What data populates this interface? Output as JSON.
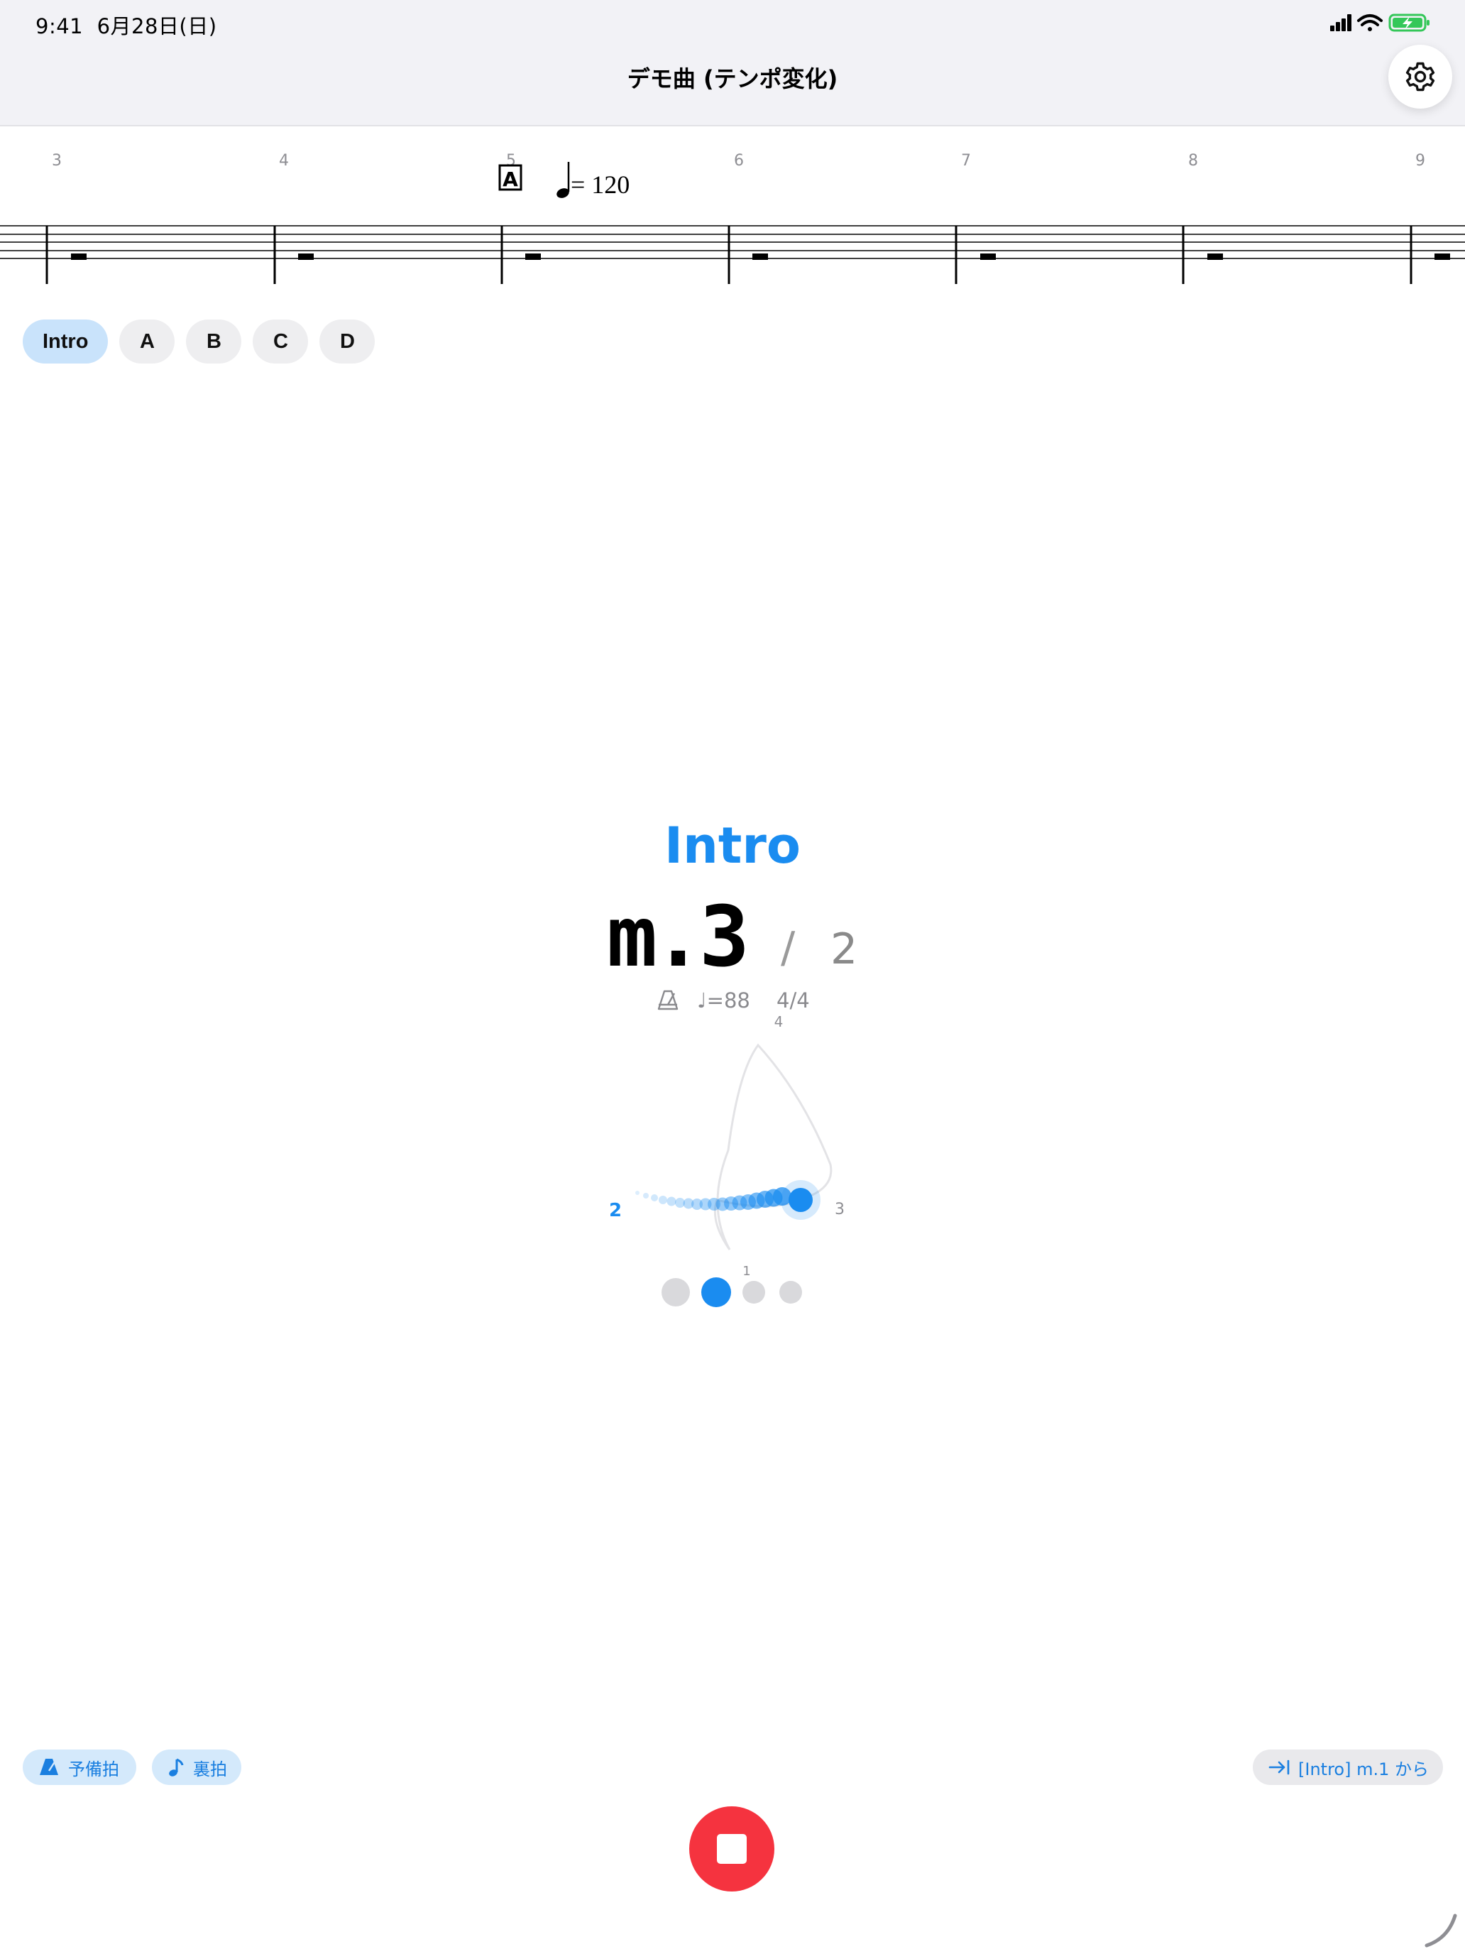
{
  "status_bar": {
    "time": "9:41",
    "date": "6月28日(日)",
    "icons": [
      "cellular-signal-icon",
      "wifi-icon",
      "battery-charging-icon"
    ],
    "battery_color": "#34c759"
  },
  "header": {
    "title": "デモ曲 (テンポ変化)",
    "settings_icon": "gear-icon"
  },
  "score": {
    "measure_numbers": [
      "3",
      "4",
      "5",
      "6",
      "7",
      "8",
      "9"
    ],
    "rehearsal_mark": "A",
    "tempo_marking": "= 120",
    "rest_type": "whole-rest"
  },
  "sections": {
    "items": [
      {
        "label": "Intro",
        "active": true
      },
      {
        "label": "A",
        "active": false
      },
      {
        "label": "B",
        "active": false
      },
      {
        "label": "C",
        "active": false
      },
      {
        "label": "D",
        "active": false
      }
    ]
  },
  "display": {
    "section_name": "Intro",
    "measure_current": "m.3",
    "measure_slash": "/",
    "measure_total": "2",
    "tempo": "♩=88",
    "time_signature": "4/4",
    "metronome_icon": "metronome-icon"
  },
  "diagram": {
    "beat_labels": {
      "one": "1",
      "two": "2",
      "three": "3",
      "four": "4"
    },
    "active_beat": "2",
    "accent_color": "#1a8cf0"
  },
  "beat_dots": {
    "count": 4,
    "active_index": 1
  },
  "controls": {
    "prep_beat_label": "予備拍",
    "offbeat_label": "裏拍",
    "start_from_label": "[Intro] m.1 から",
    "stop_color": "#f5333f"
  }
}
